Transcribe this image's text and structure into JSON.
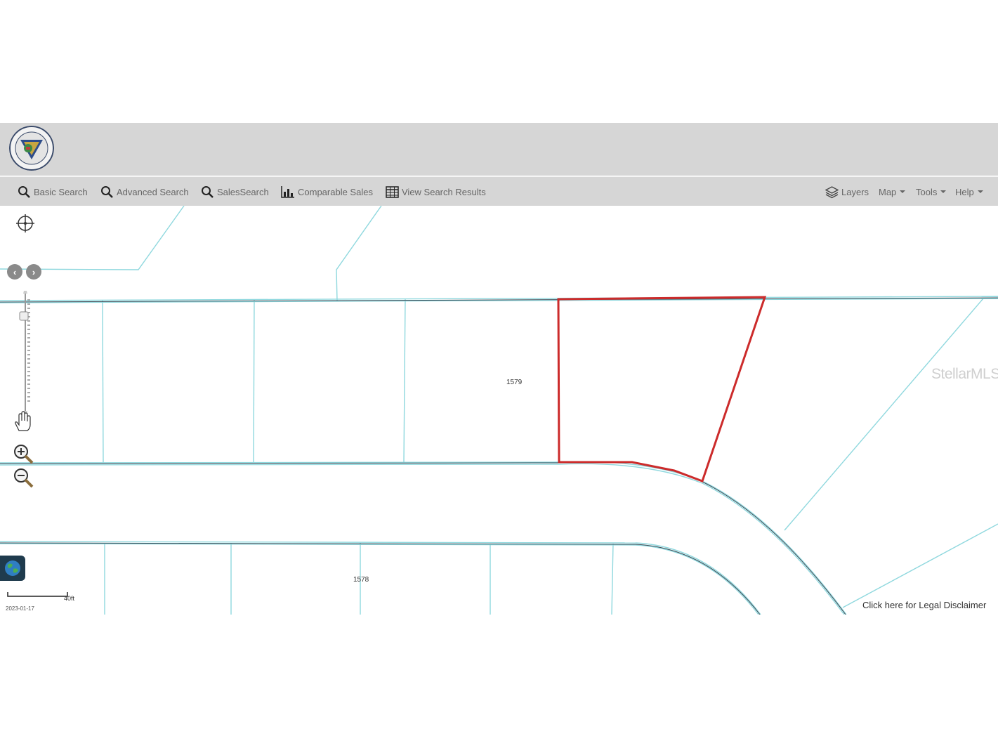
{
  "toolbar": {
    "items": [
      {
        "label": "Basic Search",
        "icon": "search-icon"
      },
      {
        "label": "Advanced Search",
        "icon": "search-icon"
      },
      {
        "label": "SalesSearch",
        "icon": "search-icon"
      },
      {
        "label": "Comparable Sales",
        "icon": "bar-chart-icon"
      },
      {
        "label": "View Search Results",
        "icon": "table-icon"
      }
    ],
    "right": [
      {
        "label": "Layers",
        "icon": "layers-icon"
      },
      {
        "label": "Map"
      },
      {
        "label": "Tools"
      },
      {
        "label": "Help"
      }
    ]
  },
  "map": {
    "parcel_labels": [
      "1579",
      "1578"
    ],
    "watermark": "StellarMLS",
    "disclaimer": "Click here for Legal Disclaimer",
    "scale_label": "40ft",
    "date": "2023-01-17",
    "highlight_color": "#cc2b2b",
    "parcel_line_color": "#8fd8de"
  }
}
